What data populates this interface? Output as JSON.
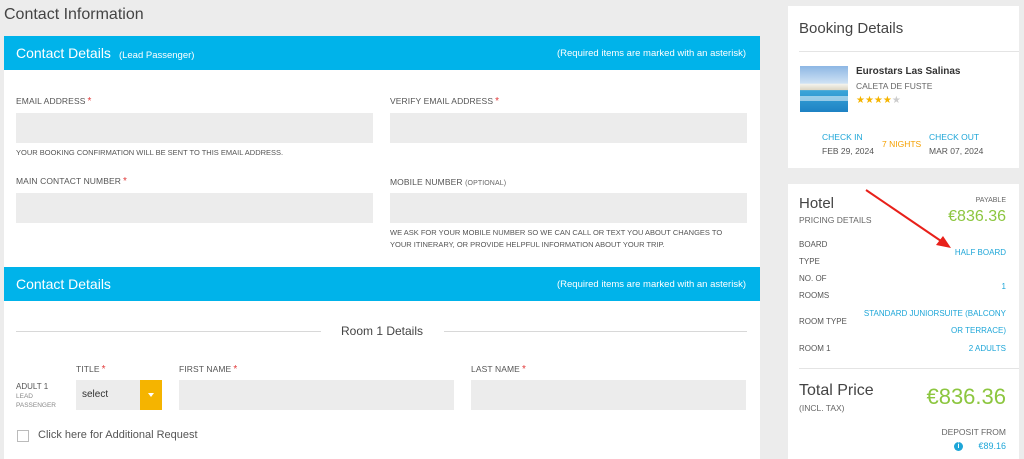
{
  "page": {
    "title": "Contact Information"
  },
  "contact_section": {
    "title": "Contact Details",
    "subtitle": "(Lead Passenger)",
    "required_note": "(Required items are marked with an asterisk)",
    "email_label": "EMAIL ADDRESS",
    "verify_email_label": "VERIFY EMAIL ADDRESS",
    "email_hint": "YOUR BOOKING CONFIRMATION WILL BE SENT TO THIS EMAIL ADDRESS.",
    "main_number_label": "MAIN CONTACT NUMBER",
    "mobile_label": "MOBILE NUMBER",
    "mobile_optional": "(OPTIONAL)",
    "mobile_hint_1": "WE ASK FOR YOUR MOBILE NUMBER SO WE CAN CALL OR TEXT YOU ABOUT CHANGES TO",
    "mobile_hint_2": "YOUR ITINERARY, OR PROVIDE HELPFUL INFORMATION ABOUT YOUR TRIP.",
    "asterisk": "*"
  },
  "room_section": {
    "title": "Contact Details",
    "required_note": "(Required items are marked with an asterisk)",
    "room_title": "Room 1 Details",
    "adult_label": "ADULT 1",
    "adult_sub": "LEAD PASSENGER",
    "title_label": "TITLE",
    "title_select_value": "select",
    "first_name_label": "FIRST NAME",
    "last_name_label": "LAST NAME",
    "additional_request": "Click here for Additional Request"
  },
  "booking": {
    "title": "Booking Details",
    "hotel_name": "Eurostars Las Salinas",
    "location": "CALETA DE FUSTE",
    "stars_on": "★★★★",
    "stars_off": "★",
    "check_in_label": "CHECK IN",
    "check_in_date": "FEB 29, 2024",
    "nights": "7 NIGHTS",
    "check_out_label": "CHECK OUT",
    "check_out_date": "MAR 07, 2024"
  },
  "pricing": {
    "title": "Hotel",
    "subtitle": "PRICING DETAILS",
    "payable_label": "PAYABLE",
    "payable_amount": "€836.36",
    "board_type_label_1": "BOARD",
    "board_type_label_2": "TYPE",
    "board_type_value": "HALF BOARD",
    "rooms_label_1": "NO. OF",
    "rooms_label_2": "ROOMS",
    "rooms_value": "1",
    "room_type_label": "ROOM TYPE",
    "room_type_value_1": "STANDARD JUNIORSUITE (BALCONY",
    "room_type_value_2": "OR TERRACE)",
    "room1_label": "ROOM 1",
    "room1_value": "2 ADULTS",
    "total_label": "Total Price",
    "total_sub": "(INCL. TAX)",
    "total_amount": "€836.36",
    "deposit_label": "DEPOSIT FROM",
    "deposit_amount": "€89.16",
    "info_glyph": "i"
  },
  "colors": {
    "accent": "#00b3ea",
    "price_green": "#8cc63f",
    "link_blue": "#1ea6d8",
    "select_yellow": "#f5b400",
    "annotation_red": "#e8201a"
  }
}
